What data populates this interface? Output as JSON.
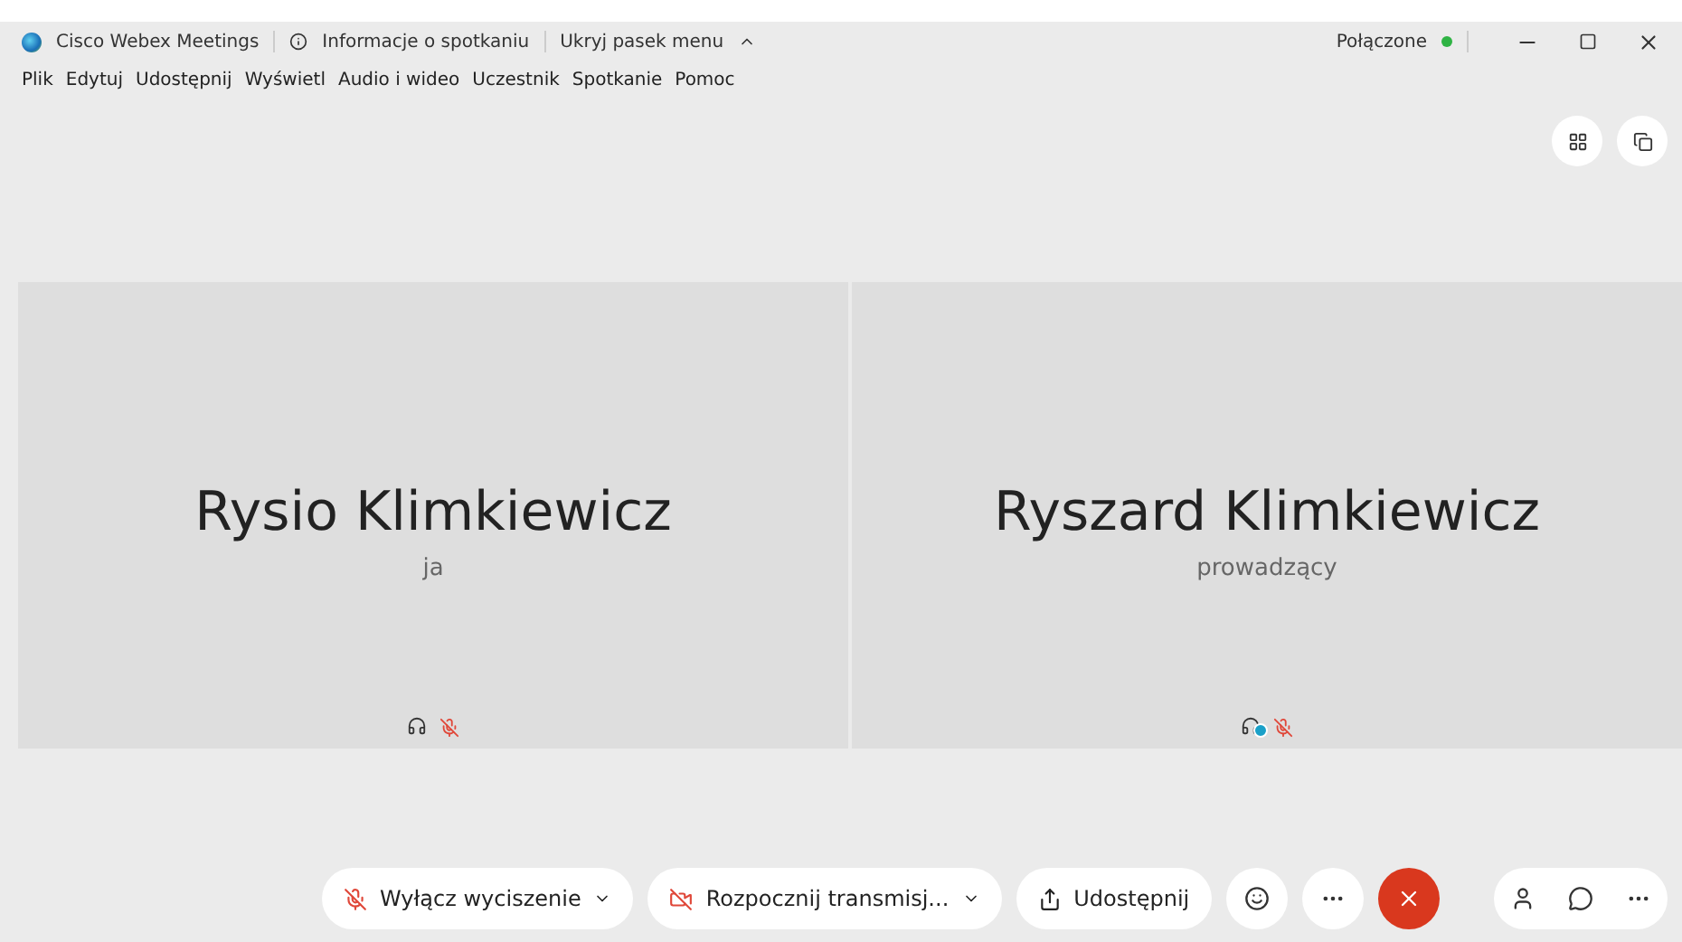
{
  "title_bar": {
    "app_name": "Cisco Webex Meetings",
    "info": "Informacje o spotkaniu",
    "hide_menu": "Ukryj pasek menu",
    "status": "Połączone"
  },
  "menu": [
    "Plik",
    "Edytuj",
    "Udostępnij",
    "Wyświetl",
    "Audio i wideo",
    "Uczestnik",
    "Spotkanie",
    "Pomoc"
  ],
  "participants": [
    {
      "name": "Rysio Klimkiewicz",
      "role": "ja",
      "host": false,
      "muted": true
    },
    {
      "name": "Ryszard Klimkiewicz",
      "role": "prowadzący",
      "host": true,
      "muted": true
    }
  ],
  "controls": [
    {
      "kind": "mute",
      "label": "Wyłącz wyciszenie",
      "dropdown": true
    },
    {
      "kind": "video",
      "label": "Rozpocznij transmisj...",
      "dropdown": true
    },
    {
      "kind": "share",
      "label": "Udostępnij",
      "dropdown": false
    }
  ]
}
